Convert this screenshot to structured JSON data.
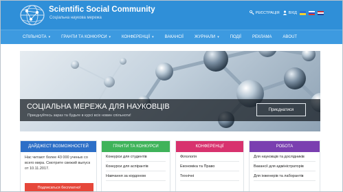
{
  "header": {
    "title": "Scientific Social Community",
    "subtitle": "Соціальна наукова мережа",
    "login_links": [
      {
        "label": "РЕЄСТРАЦІЯ",
        "icon": "key-icon"
      },
      {
        "label": "ВХІД",
        "icon": "users-icon"
      }
    ],
    "languages": [
      {
        "name": "ua",
        "colors": [
          "#2a6cd6",
          "#f4d22c"
        ]
      },
      {
        "name": "ru",
        "colors": [
          "#ffffff",
          "#2a4fd0",
          "#d73a2e"
        ]
      },
      {
        "name": "en",
        "colors": [
          "#c8323a",
          "#ffffff",
          "#2b3f8f"
        ]
      }
    ]
  },
  "nav": [
    {
      "label": "СПІЛЬНОТА",
      "dropdown": true
    },
    {
      "label": "ГРАНТИ ТА КОНКУРСИ",
      "dropdown": true
    },
    {
      "label": "КОНФЕРЕНЦІЇ",
      "dropdown": true
    },
    {
      "label": "ВАКАНСІЇ",
      "dropdown": false
    },
    {
      "label": "ЖУРНАЛИ",
      "dropdown": true
    },
    {
      "label": "ПОДІЇ",
      "dropdown": false
    },
    {
      "label": "РЕКЛАМА",
      "dropdown": false
    },
    {
      "label": "ABOUT",
      "dropdown": false
    }
  ],
  "hero": {
    "title": "СОЦІАЛЬНА МЕРЕЖА ДЛЯ НАУКОВЦІВ",
    "subtitle": "Приєднуйтесь зараз та будьте в курсі всіх новин спільноти!",
    "button": "Приєднатися"
  },
  "cards": {
    "digest": {
      "title": "ДАЙДЖЕСТ ВОЗМОЖНОСТЕЙ",
      "color": "#2d6fc7",
      "text": "Нас читают более 43 000 ученых со всего мира. Смотрите свежий выпуск от 10.11.2017.",
      "button": "Подписаться бесплатно!"
    },
    "grants": {
      "title": "ГРАНТИ ТА КОНКУРСИ",
      "color": "#3fb35a",
      "items": [
        "Конкурси для студентів",
        "Конкурси для аспірантів",
        "Навчання за кордоном"
      ]
    },
    "conferences": {
      "title": "КОНФЕРЕНЦІЇ",
      "color": "#d8326e",
      "items": [
        "Філологія",
        "Економіка та Право",
        "Технічні"
      ]
    },
    "jobs": {
      "title": "РОБОТА",
      "color": "#7a3fb0",
      "items": [
        "Для науковців та дослідників",
        "Вакансії для адміністраторів",
        "Для інженерів та лаборантів"
      ]
    }
  }
}
